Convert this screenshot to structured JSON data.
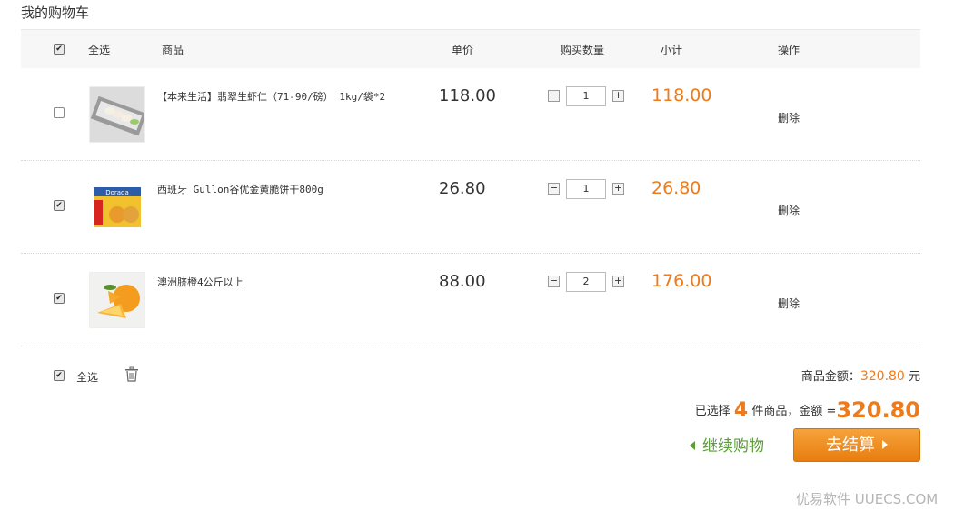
{
  "page": {
    "title": "我的购物车"
  },
  "header": {
    "select_all": "全选",
    "product": "商品",
    "unit_price": "单价",
    "quantity": "购买数量",
    "subtotal": "小计",
    "action": "操作"
  },
  "items": [
    {
      "checked": false,
      "name": "【本来生活】翡翠生虾仁（71-90/磅） 1kg/袋*2",
      "price": "118.00",
      "qty": "1",
      "subtotal": "118.00",
      "delete": "删除",
      "thumb_icon": "shrimp-image"
    },
    {
      "checked": true,
      "name": "西班牙 Gullon谷优金黄脆饼干800g",
      "price": "26.80",
      "qty": "1",
      "subtotal": "26.80",
      "delete": "删除",
      "thumb_icon": "cracker-box-image"
    },
    {
      "checked": true,
      "name": "澳洲脐橙4公斤以上",
      "price": "88.00",
      "qty": "2",
      "subtotal": "176.00",
      "delete": "删除",
      "thumb_icon": "orange-image"
    }
  ],
  "footer": {
    "select_all": "全选",
    "goods_total_label": "商品金额：",
    "goods_total_value": "320.80",
    "currency": "元",
    "selected_prefix": "已选择",
    "selected_count": "4",
    "selected_suffix": "件商品，金额 =",
    "total": "320.80",
    "continue_label": "继续购物",
    "checkout_label": "去结算"
  },
  "watermark": "优易软件 UUECS.COM",
  "colors": {
    "accent": "#ee7b1b",
    "continue": "#5b9d38",
    "checkout": "#f29a2e"
  }
}
